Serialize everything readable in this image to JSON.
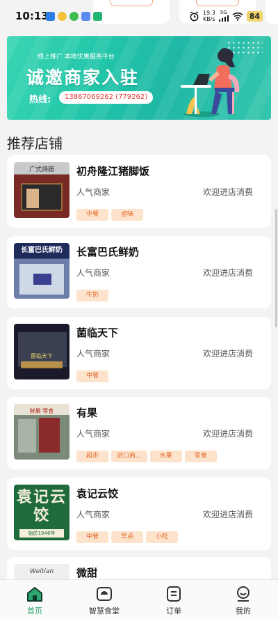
{
  "status_bar": {
    "time": "10:13",
    "net_speed_value": "19.3",
    "net_speed_unit": "KB/s",
    "signal": "5G",
    "battery": "84"
  },
  "banner": {
    "subtitle": "线上推广 本地优惠服务平台",
    "headline": "诚邀商家入驻",
    "hotline_label": "热线:",
    "hotline_number": "13867069262 (779262)"
  },
  "section_title": "推荐店铺",
  "shops": [
    {
      "name": "初舟隆江猪脚饭",
      "type": "人气商家",
      "welcome": "欢迎进店消费",
      "tags": [
        "中餐",
        "卤味"
      ],
      "sign": "广式烧腊"
    },
    {
      "name": "长富巴氏鲜奶",
      "type": "人气商家",
      "welcome": "欢迎进店消费",
      "tags": [
        "牛奶"
      ],
      "sign": "长富巴氏鲜奶"
    },
    {
      "name": "菌临天下",
      "type": "人气商家",
      "welcome": "欢迎进店消费",
      "tags": [
        "中餐"
      ],
      "sign": "菌临天下"
    },
    {
      "name": "有果",
      "type": "人气商家",
      "welcome": "欢迎进店消费",
      "tags": [
        "超市",
        "进口商...",
        "水果",
        "零食"
      ],
      "sign": "鲜果·零食"
    },
    {
      "name": "袁记云饺",
      "type": "人气商家",
      "welcome": "欢迎进店消费",
      "tags": [
        "中餐",
        "早点",
        "小吃"
      ],
      "sign": "袁记云饺",
      "sign_sub": "始於1946年"
    },
    {
      "name": "微甜",
      "type": "",
      "welcome": "",
      "tags": [],
      "sign": "Weitian"
    }
  ],
  "nav": {
    "items": [
      {
        "label": "首页",
        "icon": "home-icon",
        "active": true
      },
      {
        "label": "智慧食堂",
        "icon": "canteen-icon",
        "active": false
      },
      {
        "label": "订单",
        "icon": "order-icon",
        "active": false
      },
      {
        "label": "我的",
        "icon": "profile-icon",
        "active": false
      }
    ]
  },
  "colors": {
    "accent_green": "#2aa66e",
    "banner_teal": "#22c6a9",
    "tag_bg": "#fde3cc",
    "tag_text": "#e2682a",
    "hotline_red": "#e53935"
  }
}
